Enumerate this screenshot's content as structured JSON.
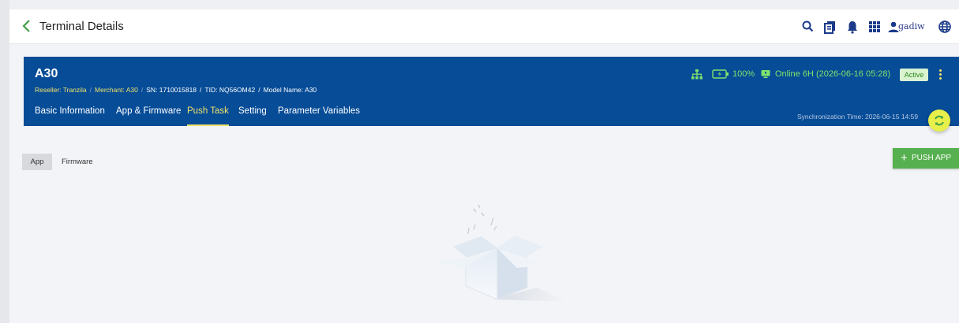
{
  "header": {
    "title": "Terminal Details",
    "username": "gadiw",
    "icons": [
      "back-chevron-icon",
      "search-icon",
      "document-icon",
      "bell-icon",
      "apps-grid-icon",
      "user-icon",
      "globe-icon"
    ]
  },
  "device": {
    "name": "A30",
    "reseller": "Reseller: Tranzila",
    "merchant": "Merchant: A30",
    "sn": "SN: 1710015818",
    "tid": "TID: NQ56OM42",
    "model": "Model Name: A30",
    "battery": "100%",
    "online": "Online 6H (2026-06-16 05:28)",
    "status_badge": "Active",
    "sync_time": "Synchronization Time: 2026-06-15 14:59"
  },
  "tabs": [
    {
      "label": "Basic Information",
      "active": false
    },
    {
      "label": "App & Firmware",
      "active": false
    },
    {
      "label": "Push Task",
      "active": true
    },
    {
      "label": "Setting",
      "active": false
    },
    {
      "label": "Parameter Variables",
      "active": false
    }
  ],
  "content": {
    "segments": [
      "App",
      "Firmware"
    ],
    "selected_segment": "App",
    "push_button": "PUSH APP"
  },
  "colors": {
    "header_blue": "#064c97",
    "accent_yellow": "#f0e26a",
    "online_green": "#7ee36b",
    "push_green": "#57b04f"
  }
}
